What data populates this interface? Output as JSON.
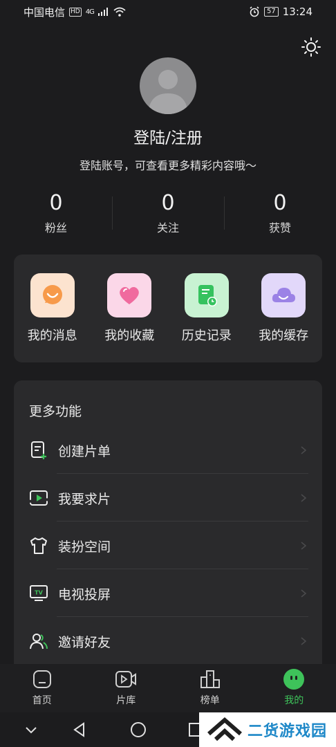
{
  "status_bar": {
    "carrier": "中国电信",
    "hd": "HD",
    "network": "4G",
    "battery": "57",
    "time": "13:24"
  },
  "profile": {
    "login_title": "登陆/注册",
    "login_subtitle": "登陆账号，可查看更多精彩内容哦～"
  },
  "stats": [
    {
      "value": "0",
      "label": "粉丝"
    },
    {
      "value": "0",
      "label": "关注"
    },
    {
      "value": "0",
      "label": "获赞"
    }
  ],
  "quick_actions": [
    {
      "label": "我的消息",
      "icon": "message-icon",
      "color": "#f79a4a"
    },
    {
      "label": "我的收藏",
      "icon": "heart-icon",
      "color": "#f06a9e"
    },
    {
      "label": "历史记录",
      "icon": "history-icon",
      "color": "#35c25e"
    },
    {
      "label": "我的缓存",
      "icon": "cloud-icon",
      "color": "#9b82e6"
    }
  ],
  "more": {
    "title": "更多功能",
    "items": [
      {
        "label": "创建片单",
        "icon": "create-list-icon"
      },
      {
        "label": "我要求片",
        "icon": "request-video-icon"
      },
      {
        "label": "装扮空间",
        "icon": "shirt-icon"
      },
      {
        "label": "电视投屏",
        "icon": "tv-cast-icon"
      },
      {
        "label": "邀请好友",
        "icon": "invite-friends-icon"
      }
    ]
  },
  "tabs": [
    {
      "label": "首页",
      "icon": "home-icon",
      "active": false
    },
    {
      "label": "片库",
      "icon": "video-library-icon",
      "active": false
    },
    {
      "label": "榜单",
      "icon": "ranking-icon",
      "active": false
    },
    {
      "label": "我的",
      "icon": "profile-icon",
      "active": true
    }
  ],
  "watermark": {
    "text": "二货游戏园"
  },
  "colors": {
    "background": "#1c1c1e",
    "card": "#2a2a2c",
    "accent": "#3ec25a"
  }
}
